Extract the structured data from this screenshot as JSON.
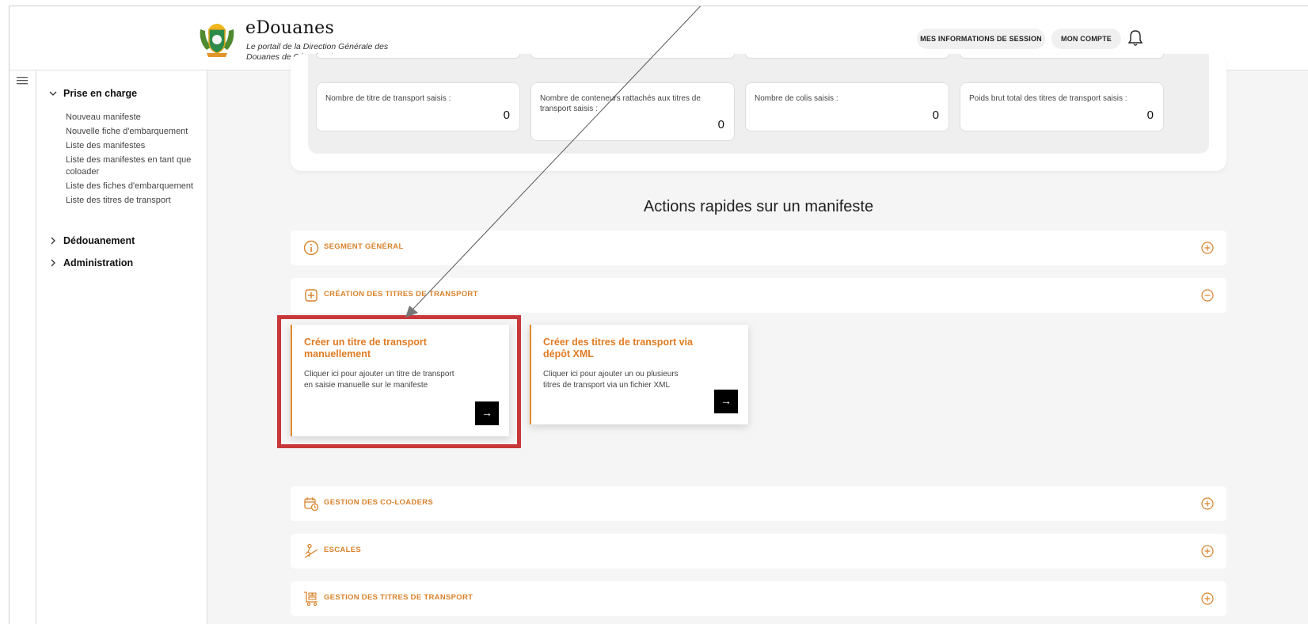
{
  "header": {
    "brand_title": "eDouanes",
    "brand_subtitle": "Le portail de la Direction Générale des Douanes de Côte d'Ivoire",
    "session_button": "MES INFORMATIONS DE SESSION",
    "account_button": "MON COMPTE",
    "bell_icon": "bell-icon"
  },
  "sidebar": {
    "menu_icon": "hamburger-icon",
    "sections": [
      {
        "label": "Prise en charge",
        "expanded": true
      },
      {
        "label": "Dédouanement",
        "expanded": false
      },
      {
        "label": "Administration",
        "expanded": false
      }
    ],
    "items": [
      "Nouveau manifeste",
      "Nouvelle fiche d'embarquement",
      "Liste des manifestes",
      "Liste des manifestes en tant que coloader",
      "Liste des fiches d'embarquement",
      "Liste des titres de transport"
    ]
  },
  "stats": [
    {
      "label": "Nombre de titre de transport saisis :",
      "value": "0"
    },
    {
      "label": "Nombre de conteneurs rattachés aux titres de transport saisis :",
      "value": "0"
    },
    {
      "label": "Nombre de colis saisis :",
      "value": "0"
    },
    {
      "label": "Poids brut total des titres de transport saisis :",
      "value": "0"
    }
  ],
  "quick_actions": {
    "title": "Actions rapides sur un manifeste",
    "sections": [
      {
        "label": "SEGMENT GÉNÉRAL",
        "icon": "info-circle-icon",
        "expanded": false
      },
      {
        "label": "CRÉATION DES TITRES DE TRANSPORT",
        "icon": "plus-square-icon",
        "expanded": true
      },
      {
        "label": "GESTION DES CO-LOADERS",
        "icon": "calendar-clock-icon",
        "expanded": false
      },
      {
        "label": "ESCALES",
        "icon": "ramp-icon",
        "expanded": false
      },
      {
        "label": "GESTION DES TITRES DE TRANSPORT",
        "icon": "cart-list-icon",
        "expanded": false
      }
    ],
    "cards": [
      {
        "title": "Créer un titre de transport manuellement",
        "description": "Cliquer ici pour ajouter un titre de transport en saisie manuelle sur le manifeste",
        "action": "→"
      },
      {
        "title": "Créer des titres de transport via dépôt XML",
        "description": "Cliquer ici pour ajouter un ou plusieurs titres de transport via un fichier XML",
        "action": "→"
      }
    ]
  },
  "colors": {
    "accent": "#e07b22",
    "highlight": "#c8383a",
    "background": "#f5f5f5"
  }
}
